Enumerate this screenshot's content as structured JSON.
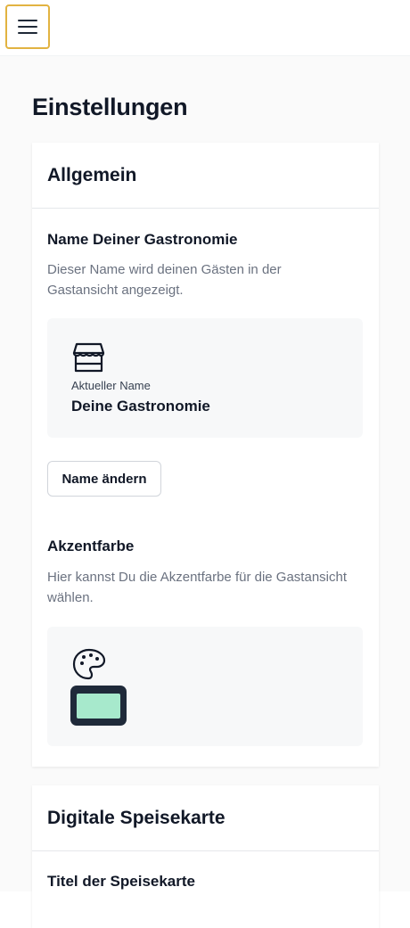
{
  "page": {
    "title": "Einstellungen"
  },
  "general": {
    "heading": "Allgemein",
    "name_section": {
      "title": "Name Deiner Gastronomie",
      "description": "Dieser Name wird deinen Gästen in der Gastansicht angezeigt.",
      "current_label": "Aktueller Name",
      "current_value": "Deine Gastronomie",
      "change_button": "Name ändern"
    },
    "accent_section": {
      "title": "Akzentfarbe",
      "description": "Hier kannst Du die Akzentfarbe für die Gastansicht wählen.",
      "accent_color": "#a7e9cc"
    }
  },
  "menu_card": {
    "heading": "Digitale Speisekarte",
    "title_section": {
      "title": "Titel der Speisekarte"
    }
  },
  "icons": {
    "menu": "hamburger-menu-icon",
    "store": "store-icon",
    "palette": "palette-icon"
  },
  "colors": {
    "focus_ring": "#e2b341",
    "swatch_frame": "#1f2a3a",
    "panel_background": "#f7f8f9"
  }
}
